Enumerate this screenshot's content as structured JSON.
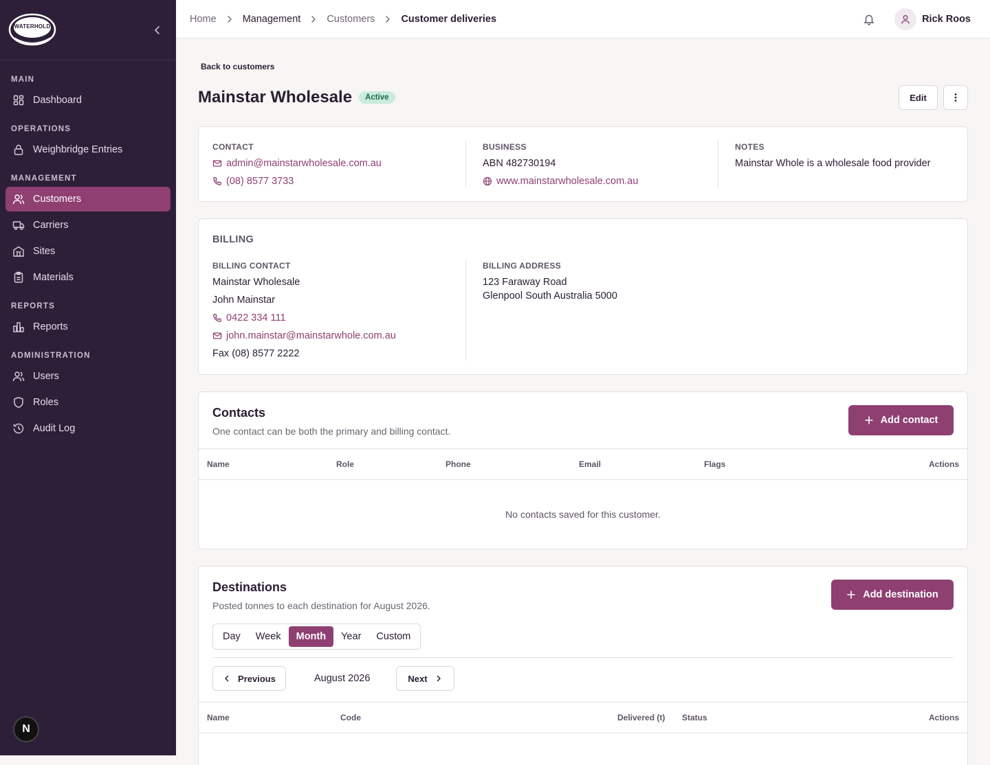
{
  "brand": {
    "logo_text": "WATERHOLD"
  },
  "sidebar": {
    "sections": [
      {
        "title": "MAIN",
        "items": [
          {
            "label": "Dashboard",
            "icon": "dashboard-icon"
          }
        ]
      },
      {
        "title": "OPERATIONS",
        "items": [
          {
            "label": "Weighbridge Entries",
            "icon": "lock-icon"
          }
        ]
      },
      {
        "title": "MANAGEMENT",
        "items": [
          {
            "label": "Customers",
            "icon": "users-icon",
            "active": true
          },
          {
            "label": "Carriers",
            "icon": "truck-icon"
          },
          {
            "label": "Sites",
            "icon": "building-icon"
          },
          {
            "label": "Materials",
            "icon": "clipboard-icon"
          }
        ]
      },
      {
        "title": "REPORTS",
        "items": [
          {
            "label": "Reports",
            "icon": "bar-chart-icon"
          }
        ]
      },
      {
        "title": "ADMINISTRATION",
        "items": [
          {
            "label": "Users",
            "icon": "users-icon"
          },
          {
            "label": "Roles",
            "icon": "shield-icon"
          },
          {
            "label": "Audit Log",
            "icon": "history-icon"
          }
        ]
      }
    ],
    "badge": "N"
  },
  "breadcrumb": [
    "Home",
    "Management",
    "Customers",
    "Customer deliveries"
  ],
  "user": {
    "name": "Rick Roos"
  },
  "page": {
    "back_link": "Back to customers",
    "title": "Mainstar Wholesale",
    "status": "Active",
    "edit_label": "Edit"
  },
  "overview": {
    "contact": {
      "label": "CONTACT",
      "email": "admin@mainstarwholesale.com.au",
      "phone": "(08) 8577 3733"
    },
    "business": {
      "label": "BUSINESS",
      "abn": "ABN 482730194",
      "website": "www.mainstarwholesale.com.au"
    },
    "notes": {
      "label": "NOTES",
      "text": "Mainstar Whole is a wholesale food provider"
    }
  },
  "billing": {
    "title": "BILLING",
    "contact_label": "BILLING CONTACT",
    "company": "Mainstar Wholesale",
    "person": "John Mainstar",
    "phone": "0422 334 111",
    "email": "john.mainstar@mainstarwhole.com.au",
    "fax": "Fax (08) 8577 2222",
    "address_label": "BILLING ADDRESS",
    "address_line1": "123 Faraway Road",
    "address_line2": "Glenpool South Australia 5000"
  },
  "contacts": {
    "title": "Contacts",
    "subtitle": "One contact can be both the primary and billing contact.",
    "add_label": "Add contact",
    "columns": [
      "Name",
      "Role",
      "Phone",
      "Email",
      "Flags",
      "Actions"
    ],
    "empty_text": "No contacts saved for this customer."
  },
  "destinations": {
    "title": "Destinations",
    "subtitle": "Posted tonnes to each destination for August 2026.",
    "add_label": "Add destination",
    "ranges": [
      "Day",
      "Week",
      "Month",
      "Year",
      "Custom"
    ],
    "active_range": "Month",
    "previous_label": "Previous",
    "period": "August 2026",
    "next_label": "Next",
    "columns": [
      "Name",
      "Code",
      "Delivered (t)",
      "Status",
      "Actions"
    ]
  },
  "colors": {
    "sidebar_bg": "#2d1f38",
    "accent": "#8f3f72",
    "status_bg": "#c9ecdc",
    "status_text": "#1f6b49"
  }
}
